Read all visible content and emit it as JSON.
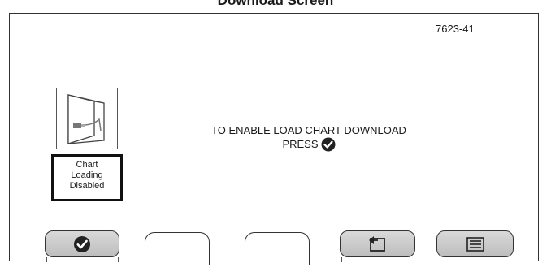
{
  "caption": "Download Screen",
  "reference_number": "7623-41",
  "status_box": {
    "lines": [
      "Chart",
      "Loading",
      "Disabled"
    ]
  },
  "message": {
    "line1": "TO ENABLE LOAD CHART DOWNLOAD",
    "line2": "PRESS"
  },
  "icons": {
    "panel": "door-usb-icon",
    "inline": "checkmark-circle-icon",
    "softkey1": "checkmark-circle-icon",
    "softkey4": "return-arrow-icon",
    "softkey5": "menu-list-icon"
  },
  "colors": {
    "pressed_key": "#c8c8c8",
    "icon_fill": "#222222"
  }
}
